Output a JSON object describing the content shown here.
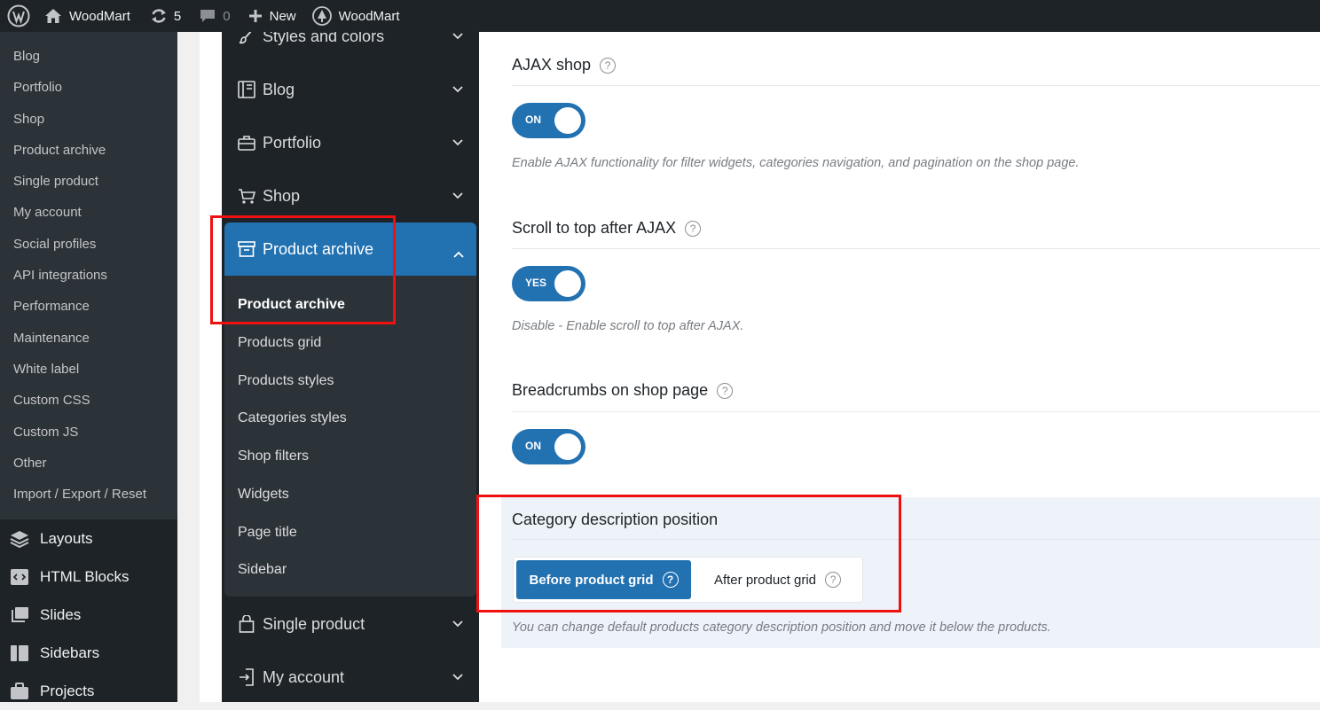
{
  "adminbar": {
    "site_name": "WoodMart",
    "updates_count": "5",
    "comments_count": "0",
    "new_label": "New",
    "theme_label": "WoodMart"
  },
  "wp_menu": {
    "submenu": [
      "Blog",
      "Portfolio",
      "Shop",
      "Product archive",
      "Single product",
      "My account",
      "Social profiles",
      "API integrations",
      "Performance",
      "Maintenance",
      "White label",
      "Custom CSS",
      "Custom JS",
      "Other",
      "Import / Export / Reset"
    ],
    "main": [
      {
        "label": "Layouts",
        "icon": "layers-icon"
      },
      {
        "label": "HTML Blocks",
        "icon": "code-block-icon"
      },
      {
        "label": "Slides",
        "icon": "slides-icon"
      },
      {
        "label": "Sidebars",
        "icon": "sidebar-icon"
      },
      {
        "label": "Projects",
        "icon": "briefcase-icon"
      }
    ]
  },
  "options_nav": {
    "items": [
      {
        "label": "Styles and colors",
        "icon": "brush-icon"
      },
      {
        "label": "Blog",
        "icon": "book-icon"
      },
      {
        "label": "Portfolio",
        "icon": "briefcase-icon"
      },
      {
        "label": "Shop",
        "icon": "cart-icon"
      }
    ],
    "active": {
      "label": "Product archive",
      "icon": "archive-box-icon"
    },
    "active_sub": [
      "Product archive",
      "Products grid",
      "Products styles",
      "Categories styles",
      "Shop filters",
      "Widgets",
      "Page title",
      "Sidebar"
    ],
    "after": [
      {
        "label": "Single product",
        "icon": "bag-icon"
      },
      {
        "label": "My account",
        "icon": "login-icon"
      }
    ]
  },
  "fields": {
    "ajax_shop": {
      "title": "AJAX shop",
      "toggle": "ON",
      "desc": "Enable AJAX functionality for filter widgets, categories navigation, and pagination on the shop page."
    },
    "scroll_top": {
      "title": "Scroll to top after AJAX",
      "toggle": "YES",
      "desc": "Disable - Enable scroll to top after AJAX."
    },
    "breadcrumbs": {
      "title": "Breadcrumbs on shop page",
      "toggle": "ON"
    },
    "category_desc": {
      "title": "Category description position",
      "options": [
        "Before product grid",
        "After product grid"
      ],
      "selected": "Before product grid",
      "desc": "You can change default products category description position and move it below the products."
    }
  },
  "help_mark": "?",
  "colors": {
    "accent": "#2271b1",
    "highlight": "#f01010",
    "nav_bg": "#1d2327"
  }
}
